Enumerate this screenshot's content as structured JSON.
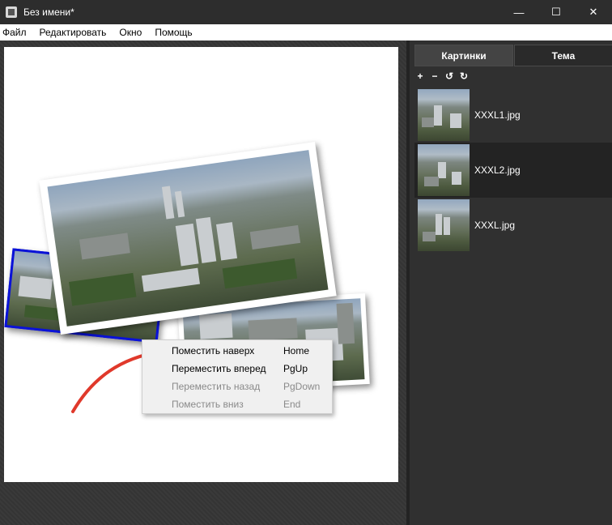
{
  "window": {
    "title": "Без имени*",
    "min": "—",
    "max": "☐",
    "close": "✕"
  },
  "menu": [
    "Файл",
    "Редактировать",
    "Окно",
    "Помощь"
  ],
  "context_menu": [
    {
      "label": "Поместить наверх",
      "shortcut": "Home",
      "enabled": true
    },
    {
      "label": "Переместить вперед",
      "shortcut": "PgUp",
      "enabled": true
    },
    {
      "label": "Переместить назад",
      "shortcut": "PgDown",
      "enabled": false
    },
    {
      "label": "Поместить вниз",
      "shortcut": "End",
      "enabled": false
    }
  ],
  "panel": {
    "tabs": [
      "Картинки",
      "Тема"
    ],
    "active_tab": "Картинки",
    "toolbar": [
      "+",
      "−",
      "↺",
      "↻"
    ],
    "images": [
      {
        "name": "XXXL1.jpg",
        "selected": false
      },
      {
        "name": "XXXL2.jpg",
        "selected": true
      },
      {
        "name": "XXXL.jpg",
        "selected": false
      }
    ]
  },
  "colors": {
    "selection_border": "#0a12d8",
    "arrow": "#e0392b",
    "panel_bg": "#303030"
  }
}
